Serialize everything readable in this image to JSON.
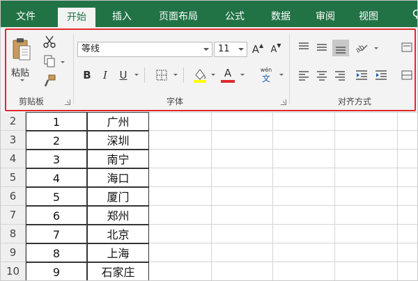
{
  "tabs": [
    {
      "label": "文件"
    },
    {
      "label": "开始",
      "active": true
    },
    {
      "label": "插入"
    },
    {
      "label": "页面布局"
    },
    {
      "label": "公式"
    },
    {
      "label": "数据"
    },
    {
      "label": "审阅"
    },
    {
      "label": "视图"
    }
  ],
  "clipboard": {
    "paste_label": "粘贴",
    "group_label": "剪贴板"
  },
  "font": {
    "font_name": "等线",
    "font_size": "11",
    "increase_label": "A",
    "decrease_label": "A",
    "bold_label": "B",
    "italic_label": "I",
    "underline_label": "U",
    "font_color_label": "A",
    "wen_label": "wén",
    "wen_char": "文",
    "group_label": "字体"
  },
  "alignment": {
    "group_label": "对齐方式"
  },
  "colors": {
    "tab_bar": "#217346",
    "highlight": "#e0282b",
    "fill_yellow": "#ffff00",
    "font_red": "#e0282b"
  },
  "rows": [
    {
      "row": "2",
      "num": "1",
      "city": "广州"
    },
    {
      "row": "3",
      "num": "2",
      "city": "深圳"
    },
    {
      "row": "4",
      "num": "3",
      "city": "南宁"
    },
    {
      "row": "5",
      "num": "4",
      "city": "海口"
    },
    {
      "row": "6",
      "num": "5",
      "city": "厦门"
    },
    {
      "row": "7",
      "num": "6",
      "city": "郑州"
    },
    {
      "row": "8",
      "num": "7",
      "city": "北京"
    },
    {
      "row": "9",
      "num": "8",
      "city": "上海"
    },
    {
      "row": "10",
      "num": "9",
      "city": "石家庄"
    }
  ]
}
